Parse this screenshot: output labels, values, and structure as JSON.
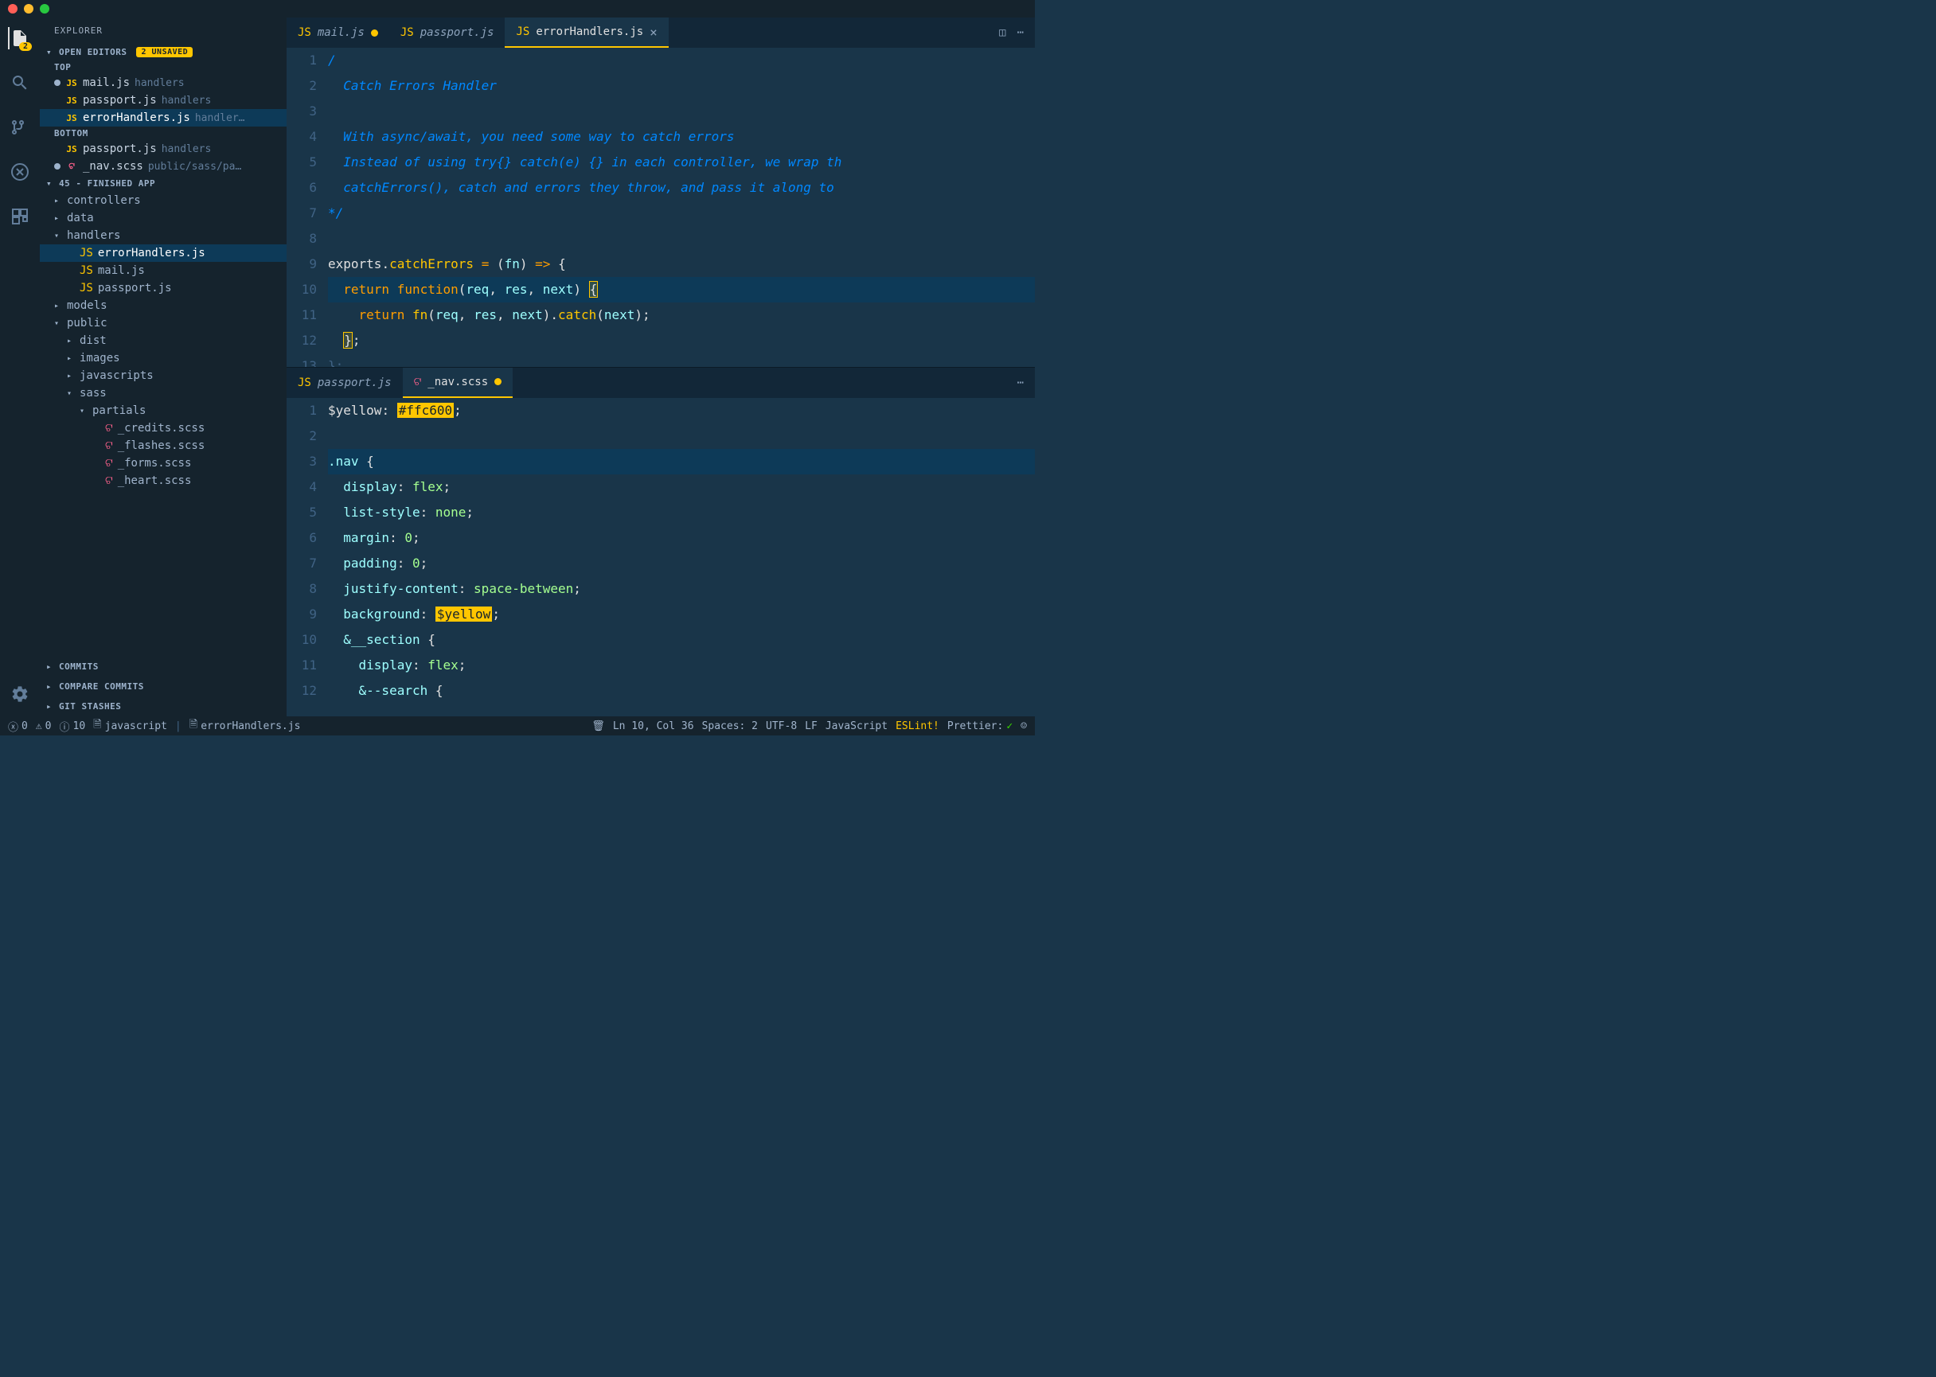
{
  "sidebar": {
    "title": "EXPLORER",
    "openEditors": {
      "label": "OPEN EDITORS",
      "unsaved": "2 UNSAVED",
      "groups": [
        {
          "label": "TOP",
          "items": [
            {
              "icon": "js",
              "name": "mail.js",
              "path": "handlers",
              "dirty": true
            },
            {
              "icon": "js",
              "name": "passport.js",
              "path": "handlers",
              "dirty": false
            },
            {
              "icon": "js",
              "name": "errorHandlers.js",
              "path": "handler…",
              "dirty": false,
              "active": true
            }
          ]
        },
        {
          "label": "BOTTOM",
          "items": [
            {
              "icon": "js",
              "name": "passport.js",
              "path": "handlers",
              "dirty": false
            },
            {
              "icon": "scss",
              "name": "_nav.scss",
              "path": "public/sass/pa…",
              "dirty": true
            }
          ]
        }
      ]
    },
    "project": {
      "label": "45 - FINISHED APP",
      "tree": [
        {
          "depth": 0,
          "expand": "closed",
          "name": "controllers"
        },
        {
          "depth": 0,
          "expand": "closed",
          "name": "data"
        },
        {
          "depth": 0,
          "expand": "open",
          "name": "handlers"
        },
        {
          "depth": 1,
          "icon": "js",
          "name": "errorHandlers.js",
          "active": true
        },
        {
          "depth": 1,
          "icon": "js",
          "name": "mail.js"
        },
        {
          "depth": 1,
          "icon": "js",
          "name": "passport.js"
        },
        {
          "depth": 0,
          "expand": "closed",
          "name": "models"
        },
        {
          "depth": 0,
          "expand": "open",
          "name": "public"
        },
        {
          "depth": 1,
          "expand": "closed",
          "name": "dist"
        },
        {
          "depth": 1,
          "expand": "closed",
          "name": "images"
        },
        {
          "depth": 1,
          "expand": "closed",
          "name": "javascripts"
        },
        {
          "depth": 1,
          "expand": "open",
          "name": "sass"
        },
        {
          "depth": 2,
          "expand": "open",
          "name": "partials"
        },
        {
          "depth": 3,
          "icon": "scss",
          "name": "_credits.scss"
        },
        {
          "depth": 3,
          "icon": "scss",
          "name": "_flashes.scss"
        },
        {
          "depth": 3,
          "icon": "scss",
          "name": "_forms.scss"
        },
        {
          "depth": 3,
          "icon": "scss",
          "name": "_heart.scss"
        }
      ]
    },
    "bottom": [
      {
        "label": "COMMITS"
      },
      {
        "label": "COMPARE COMMITS"
      },
      {
        "label": "GIT STASHES"
      }
    ]
  },
  "activity": {
    "filesBadge": "2"
  },
  "editorTop": {
    "tabs": [
      {
        "icon": "js",
        "name": "mail.js",
        "dirty": true
      },
      {
        "icon": "js",
        "name": "passport.js"
      },
      {
        "icon": "js",
        "name": "errorHandlers.js",
        "active": true,
        "close": true
      }
    ],
    "lines": [
      {
        "n": 1,
        "html": "<span class='c-comment'>/</span>"
      },
      {
        "n": 2,
        "html": "  <span class='c-comment'>Catch Errors Handler</span>"
      },
      {
        "n": 3,
        "html": ""
      },
      {
        "n": 4,
        "html": "  <span class='c-comment'>With async/await, you need some way to catch errors</span>"
      },
      {
        "n": 5,
        "html": "  <span class='c-comment'>Instead of using try{} catch(e) {} in each controller, we wrap th</span>"
      },
      {
        "n": 6,
        "html": "  <span class='c-comment'>catchErrors(), catch and errors they throw, and pass it along to </span>"
      },
      {
        "n": 7,
        "html": "<span class='c-comment'>*/</span>"
      },
      {
        "n": 8,
        "html": ""
      },
      {
        "n": 9,
        "html": "<span class='c-var'>exports</span><span class='c-punc'>.</span><span class='c-fn'>catchErrors</span> <span class='c-op'>=</span> <span class='c-punc'>(</span><span class='c-param'>fn</span><span class='c-punc'>)</span> <span class='c-op'>=&gt;</span> <span class='c-punc'>{</span>"
      },
      {
        "n": 10,
        "hl": true,
        "html": "  <span class='c-kw'>return</span> <span class='c-kw'>function</span><span class='c-punc'>(</span><span class='c-param'>req</span><span class='c-punc'>,</span> <span class='c-param'>res</span><span class='c-punc'>,</span> <span class='c-param'>next</span><span class='c-punc'>)</span> <span class='c-bracket-hl'>{</span>"
      },
      {
        "n": 11,
        "html": "    <span class='c-kw'>return</span> <span class='c-fn'>fn</span><span class='c-punc'>(</span><span class='c-param'>req</span><span class='c-punc'>,</span> <span class='c-param'>res</span><span class='c-punc'>,</span> <span class='c-param'>next</span><span class='c-punc'>).</span><span class='c-fn'>catch</span><span class='c-punc'>(</span><span class='c-param'>next</span><span class='c-punc'>);</span>"
      },
      {
        "n": 12,
        "html": "  <span class='c-bracket-hl'>}</span><span class='c-punc'>;</span>"
      },
      {
        "n": 13,
        "html": "<span class='c-punc' style='color:#406385'>};</span>"
      }
    ]
  },
  "editorBottom": {
    "tabs": [
      {
        "icon": "js",
        "name": "passport.js"
      },
      {
        "icon": "scss",
        "name": "_nav.scss",
        "active": true,
        "dirty": true
      }
    ],
    "lines": [
      {
        "n": 1,
        "html": "<span class='c-var'>$yellow</span><span class='c-punc'>:</span> <span class='c-hl'>#ffc600</span><span class='c-punc'>;</span>"
      },
      {
        "n": 2,
        "html": ""
      },
      {
        "n": 3,
        "hl": true,
        "html": "<span class='c-sel'>.nav</span> <span class='c-punc'>{</span>"
      },
      {
        "n": 4,
        "html": "  <span class='c-prop'>display</span><span class='c-punc'>:</span> <span class='c-val'>flex</span><span class='c-punc'>;</span>"
      },
      {
        "n": 5,
        "html": "  <span class='c-prop'>list-style</span><span class='c-punc'>:</span> <span class='c-val'>none</span><span class='c-punc'>;</span>"
      },
      {
        "n": 6,
        "html": "  <span class='c-prop'>margin</span><span class='c-punc'>:</span> <span class='c-val'>0</span><span class='c-punc'>;</span>"
      },
      {
        "n": 7,
        "html": "  <span class='c-prop'>padding</span><span class='c-punc'>:</span> <span class='c-val'>0</span><span class='c-punc'>;</span>"
      },
      {
        "n": 8,
        "html": "  <span class='c-prop'>justify-content</span><span class='c-punc'>:</span> <span class='c-val'>space-between</span><span class='c-punc'>;</span>"
      },
      {
        "n": 9,
        "html": "  <span class='c-prop'>background</span><span class='c-punc'>:</span> <span class='c-hl'>$yellow</span><span class='c-punc'>;</span>"
      },
      {
        "n": 10,
        "html": "  <span class='c-sel'>&amp;__section</span> <span class='c-punc'>{</span>"
      },
      {
        "n": 11,
        "html": "    <span class='c-prop'>display</span><span class='c-punc'>:</span> <span class='c-val'>flex</span><span class='c-punc'>;</span>"
      },
      {
        "n": 12,
        "html": "    <span class='c-sel'>&amp;--search</span> <span class='c-punc'>{</span>"
      }
    ]
  },
  "status": {
    "errors": "0",
    "warnings": "0",
    "info": "10",
    "lang_icon": "javascript",
    "file": "errorHandlers.js",
    "pos": "Ln 10, Col 36",
    "spaces": "Spaces: 2",
    "encoding": "UTF-8",
    "eol": "LF",
    "language": "JavaScript",
    "eslint": "ESLint!",
    "prettier": "Prettier:",
    "check": "✓"
  }
}
